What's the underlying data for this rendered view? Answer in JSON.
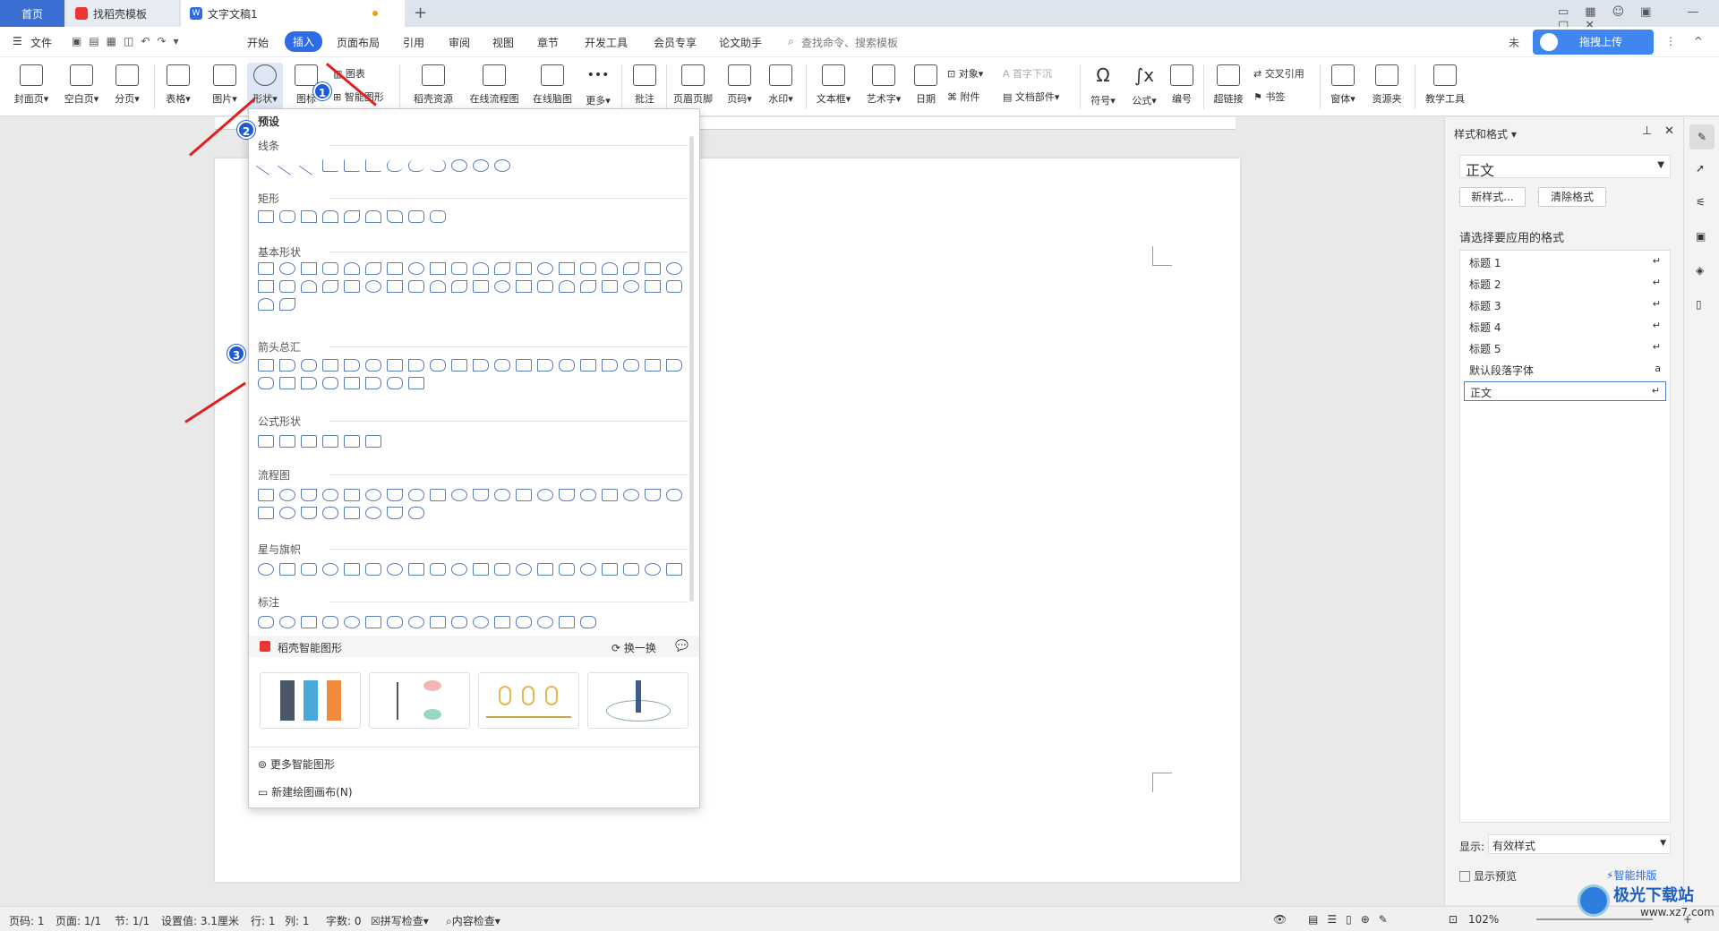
{
  "tabs": {
    "home": "首页",
    "template": "找稻壳模板",
    "doc": "文字文稿1"
  },
  "menu": {
    "file": "文件",
    "items": [
      "开始",
      "插入",
      "页面布局",
      "引用",
      "审阅",
      "视图",
      "章节",
      "开发工具",
      "会员专享",
      "论文助手"
    ],
    "search_placeholder": "查找命令、搜索模板",
    "upload": "拖拽上传",
    "unsync": "未"
  },
  "ribbon": {
    "cover": "封面页",
    "blank": "空白页",
    "pagebreak": "分页",
    "table": "表格",
    "picture": "图片",
    "shape": "形状",
    "icon": "图标",
    "chart": "图表",
    "smart_shape": "智能图形",
    "resources": "稻壳资源",
    "flowchart": "在线流程图",
    "mindmap": "在线脑图",
    "more": "更多",
    "comment": "批注",
    "header_footer": "页眉页脚",
    "page_num": "页码",
    "watermark": "水印",
    "textbox": "文本框",
    "wordart": "艺术字",
    "date": "日期",
    "object": "对象",
    "attachment": "附件",
    "dropcap": "首字下沉",
    "docparts": "文档部件",
    "symbol": "符号",
    "formula": "公式",
    "numbering": "编号",
    "hyperlink": "超链接",
    "crossref": "交叉引用",
    "bookmark": "书签",
    "window": "窗体",
    "resource_folder": "资源夹",
    "teaching": "教学工具"
  },
  "panel": {
    "preset": "预设",
    "lines": "线条",
    "rect": "矩形",
    "basic": "基本形状",
    "arrows": "箭头总汇",
    "formula": "公式形状",
    "flow": "流程图",
    "stars": "星与旗帜",
    "callouts": "标注",
    "smart_title": "稻壳智能图形",
    "refresh": "换一换",
    "more_smart": "更多智能图形",
    "new_canvas": "新建绘图画布(N)"
  },
  "badges": [
    "1",
    "2",
    "3"
  ],
  "right": {
    "title": "样式和格式",
    "current": "正文",
    "new_style": "新样式...",
    "clear": "清除格式",
    "prompt": "请选择要应用的格式",
    "styles": [
      "标题 1",
      "标题 2",
      "标题 3",
      "标题 4",
      "标题 5",
      "默认段落字体",
      "正文"
    ],
    "show_label": "显示:",
    "show_value": "有效样式",
    "preview": "显示预览",
    "smart_layout": "智能排版"
  },
  "status": {
    "page": "页码: 1",
    "pages": "页面: 1/1",
    "section": "节: 1/1",
    "setting": "设置值: 3.1厘米",
    "row": "行: 1",
    "col": "列: 1",
    "words": "字数: 0",
    "spell": "拼写检查",
    "content": "内容检查",
    "zoom": "102%"
  },
  "watermark": "极光下载站",
  "watermark_url": "www.xz7.com"
}
